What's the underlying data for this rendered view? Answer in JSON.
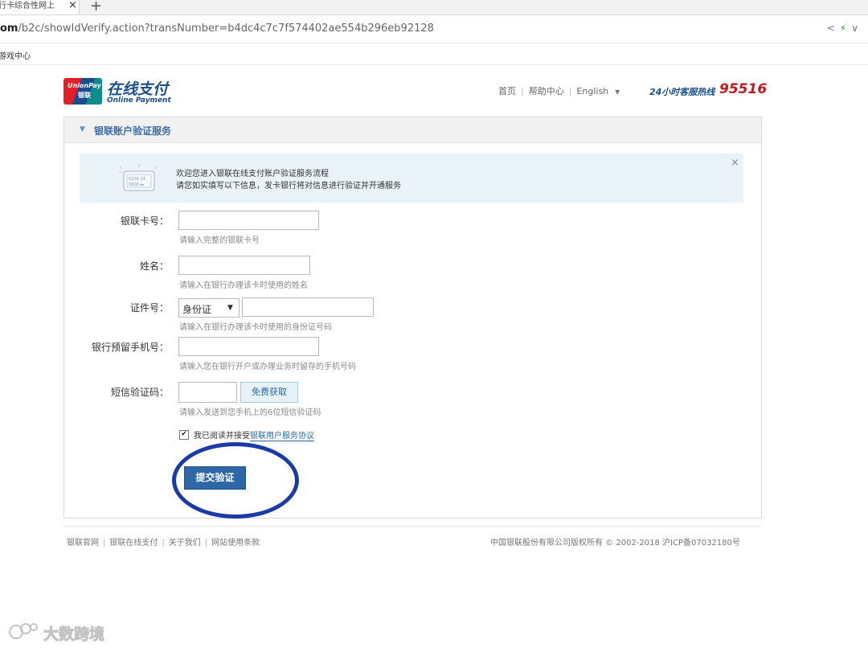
{
  "browser": {
    "tab_title": "行卡综合性网上",
    "tab_close": "×",
    "new_tab": "+",
    "url_domain": "om",
    "url_path": "/b2c/showIdVerify.action?transNumber=b4dc4c7c7f574402ae554b296eb92128",
    "bookmark": "游戏中心",
    "share_icon": "<",
    "bolt_icon": "⚡",
    "menu_icon": "∨"
  },
  "header": {
    "logo_top": "UnionPay",
    "logo_bottom": "银联",
    "logo_cn": "在线支付",
    "logo_en": "Online Payment",
    "nav_home": "首页",
    "nav_help": "帮助中心",
    "nav_lang": "English",
    "hotline_label": "24小时客服热线",
    "hotline_number": "95516"
  },
  "panel": {
    "title": "银联账户验证服务",
    "notice_line1": "欢迎您进入银联在线支付账户验证服务流程",
    "notice_line2": "请您如实填写以下信息，发卡银行将对信息进行验证并开通服务",
    "notice_close": "×",
    "card_illustration_text": "6208 24",
    "card_illustration_text2": "0808 ▸▸",
    "card_illustration_q": "?"
  },
  "form": {
    "card_label": "银联卡号：",
    "card_value": "",
    "card_hint": "请输入完整的银联卡号",
    "name_label": "姓名：",
    "name_value": "",
    "name_hint": "请输入在银行办理该卡时使用的姓名",
    "id_label": "证件号：",
    "id_type": "身份证",
    "id_value": "",
    "id_hint": "请输入在银行办理该卡时使用的身份证号码",
    "phone_label": "银行预留手机号：",
    "phone_value": "",
    "phone_hint": "请输入您在银行开户或办理业务时留存的手机号码",
    "sms_label": "短信验证码：",
    "sms_value": "",
    "sms_button": "免费获取",
    "sms_hint": "请输入发送到您手机上的6位短信验证码",
    "agree_checked": "✔",
    "agree_text": "我已阅读并接受",
    "agree_link": "银联用户服务协议",
    "submit": "提交验证"
  },
  "footer": {
    "link1": "银联官网",
    "link2": "银联在线支付",
    "link3": "关于我们",
    "link4": "网站使用条款",
    "sep": "|",
    "copyright": "中国银联股份有限公司版权所有 © 2002-2018  沪ICP备07032180号"
  },
  "watermark": {
    "text": "大数跨境"
  },
  "colors": {
    "brand_blue": "#1c4f8f",
    "brand_red": "#c8161d",
    "annotation_ring": "#1a3aa8"
  }
}
